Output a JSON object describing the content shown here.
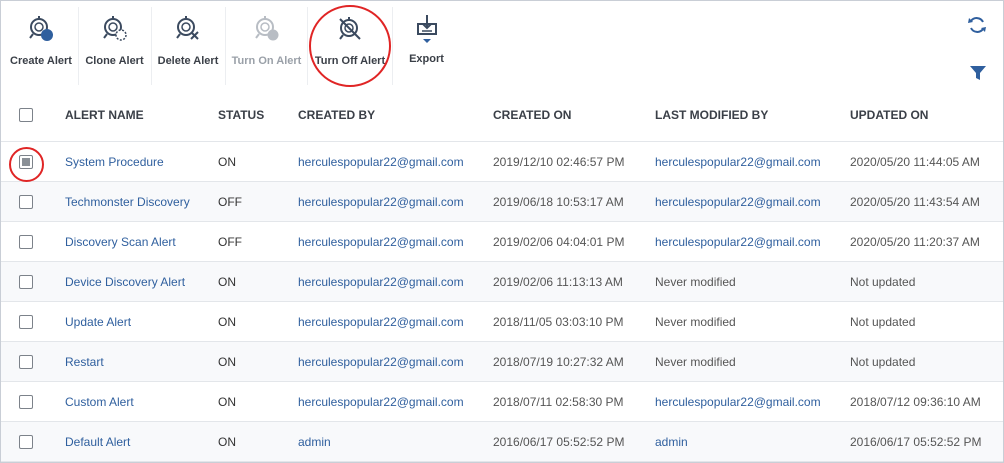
{
  "toolbar": {
    "create_alert": "Create Alert",
    "clone_alert": "Clone Alert",
    "delete_alert": "Delete Alert",
    "turn_on_alert": "Turn On Alert",
    "turn_off_alert": "Turn Off Alert",
    "export": "Export"
  },
  "table": {
    "columns": [
      "ALERT NAME",
      "STATUS",
      "CREATED BY",
      "CREATED ON",
      "LAST MODIFIED BY",
      "UPDATED ON"
    ],
    "rows": [
      {
        "checked": true,
        "name": "System Procedure",
        "status": "ON",
        "created_by": "herculespopular22@gmail.com",
        "created_on": "2019/12/10 02:46:57 PM",
        "modified_by": "herculespopular22@gmail.com",
        "updated_on": "2020/05/20 11:44:05 AM"
      },
      {
        "checked": false,
        "name": "Techmonster Discovery",
        "status": "OFF",
        "created_by": "herculespopular22@gmail.com",
        "created_on": "2019/06/18 10:53:17 AM",
        "modified_by": "herculespopular22@gmail.com",
        "updated_on": "2020/05/20 11:43:54 AM"
      },
      {
        "checked": false,
        "name": "Discovery Scan Alert",
        "status": "OFF",
        "created_by": "herculespopular22@gmail.com",
        "created_on": "2019/02/06 04:04:01 PM",
        "modified_by": "herculespopular22@gmail.com",
        "updated_on": "2020/05/20 11:20:37 AM"
      },
      {
        "checked": false,
        "name": "Device Discovery Alert",
        "status": "ON",
        "created_by": "herculespopular22@gmail.com",
        "created_on": "2019/02/06 11:13:13 AM",
        "modified_by": "Never modified",
        "updated_on": "Not updated"
      },
      {
        "checked": false,
        "name": "Update Alert",
        "status": "ON",
        "created_by": "herculespopular22@gmail.com",
        "created_on": "2018/11/05 03:03:10 PM",
        "modified_by": "Never modified",
        "updated_on": "Not updated"
      },
      {
        "checked": false,
        "name": "Restart",
        "status": "ON",
        "created_by": "herculespopular22@gmail.com",
        "created_on": "2018/07/19 10:27:32 AM",
        "modified_by": "Never modified",
        "updated_on": "Not updated"
      },
      {
        "checked": false,
        "name": "Custom Alert",
        "status": "ON",
        "created_by": "herculespopular22@gmail.com",
        "created_on": "2018/07/11 02:58:30 PM",
        "modified_by": "herculespopular22@gmail.com",
        "updated_on": "2018/07/12 09:36:10 AM"
      },
      {
        "checked": false,
        "name": "Default Alert",
        "status": "ON",
        "created_by": "admin",
        "created_on": "2016/06/17 05:52:52 PM",
        "modified_by": "admin",
        "updated_on": "2016/06/17 05:52:52 PM"
      }
    ]
  },
  "colors": {
    "link": "#2f5f9e",
    "accent": "#2f5f9e",
    "highlight": "#e02525"
  },
  "icons": [
    "create-alert-icon",
    "clone-alert-icon",
    "delete-alert-icon",
    "turn-on-alert-icon",
    "turn-off-alert-icon",
    "export-icon",
    "refresh-icon",
    "filter-icon"
  ]
}
